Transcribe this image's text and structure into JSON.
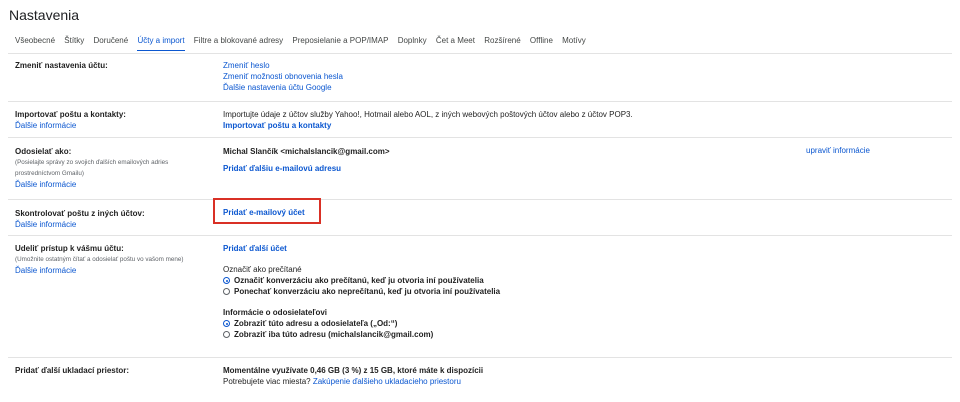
{
  "page_title": "Nastavenia",
  "tabs": [
    "Všeobecné",
    "Štítky",
    "Doručené",
    "Účty a import",
    "Filtre a blokované adresy",
    "Preposielanie a POP/IMAP",
    "Doplnky",
    "Čet a Meet",
    "Rozšírené",
    "Offline",
    "Motívy"
  ],
  "change_account": {
    "label": "Zmeniť nastavenia účtu:",
    "links": [
      "Zmeniť heslo",
      "Zmeniť možnosti obnovenia hesla",
      "Ďalšie nastavenia účtu Google"
    ]
  },
  "import": {
    "label": "Importovať poštu a kontakty:",
    "learn_more": "Ďalšie informácie",
    "description": "Importujte údaje z účtov služby Yahoo!, Hotmail alebo AOL, z iných webových poštových účtov alebo z účtov POP3.",
    "action": "Importovať poštu a kontakty"
  },
  "send_as": {
    "label": "Odosielať ako:",
    "sub": [
      "(Posielajte správy zo svojich ďalších emailových adries",
      "prostredníctvom Gmailu)"
    ],
    "learn_more": "Ďalšie informácie",
    "address": "Michal Slančík <michalslancik@gmail.com>",
    "edit": "upraviť informácie",
    "add_address": "Pridať ďalšiu e-mailovú adresu"
  },
  "check_mail": {
    "label": "Skontrolovať poštu z iných účtov:",
    "learn_more": "Ďalšie informácie",
    "add_account": "Pridať e-mailový účet"
  },
  "grant_access": {
    "label": "Udeliť prístup k vášmu účtu:",
    "sub": "(Umožnite ostatným čítať a odosielať poštu vo vašom mene)",
    "learn_more": "Ďalšie informácie",
    "add_another": "Pridať ďalší účet",
    "mark_read_title": "Označiť ako prečítané",
    "mark_read_options": [
      "Označiť konverzáciu ako prečítanú, keď ju otvoria iní používatelia",
      "Ponechať konverzáciu ako neprečítanú, keď ju otvoria iní používatelia"
    ],
    "mark_read_selected": 0,
    "sender_info_title": "Informácie o odosielateľovi",
    "sender_info_options": [
      "Zobraziť túto adresu a odosielateľa („Od:“)",
      "Zobraziť iba túto adresu (michalslancik@gmail.com)"
    ],
    "sender_info_selected": 0
  },
  "storage": {
    "label": "Pridať ďalší ukladací priestor:",
    "usage": "Momentálne využívate 0,46 GB (3 %) z 15 GB, ktoré máte k dispozícii",
    "more_prefix": "Potrebujete viac miesta?",
    "more_link": "Zakúpenie ďalšieho ukladacieho priestoru"
  }
}
